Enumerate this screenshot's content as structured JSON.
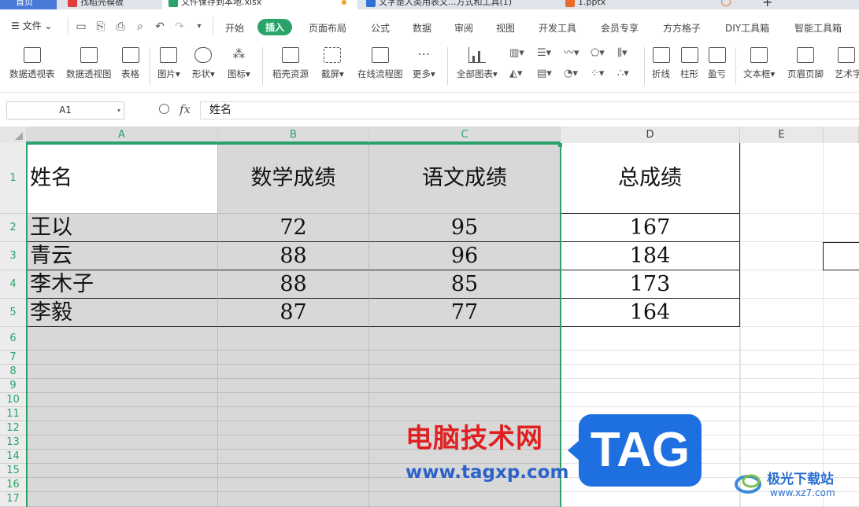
{
  "tabs": [
    {
      "id": "home",
      "label": "首页"
    },
    {
      "id": "templates",
      "label": "找稻壳模板"
    },
    {
      "id": "xlsx",
      "label": "文件保存到本地.xlsx"
    },
    {
      "id": "doc",
      "label": "文字是人类用表文...方式和工具(1)"
    },
    {
      "id": "pptx",
      "label": "1.pptx"
    }
  ],
  "menu": {
    "file_label": "文件",
    "tabs": [
      "开始",
      "插入",
      "页面布局",
      "公式",
      "数据",
      "审阅",
      "视图",
      "开发工具",
      "会员专享",
      "方方格子",
      "DIY工具箱",
      "智能工具箱"
    ],
    "active_tab": "插入"
  },
  "ribbon": {
    "buttons": [
      {
        "label": "数据透视表",
        "icon": "pivot-table-icon"
      },
      {
        "label": "数据透视图",
        "icon": "pivot-chart-icon"
      },
      {
        "label": "表格",
        "icon": "table-icon"
      },
      {
        "label": "图片",
        "icon": "picture-icon"
      },
      {
        "label": "形状",
        "icon": "shape-icon"
      },
      {
        "label": "图标",
        "icon": "icons-icon"
      },
      {
        "label": "稻壳资源",
        "icon": "resource-icon"
      },
      {
        "label": "截屏",
        "icon": "screenshot-icon"
      },
      {
        "label": "在线流程图",
        "icon": "flowchart-icon"
      },
      {
        "label": "更多",
        "icon": "more-icon"
      },
      {
        "label": "全部图表",
        "icon": "all-charts-icon"
      },
      {
        "label": "折线",
        "icon": "line-sparkline-icon"
      },
      {
        "label": "柱形",
        "icon": "column-sparkline-icon"
      },
      {
        "label": "盈亏",
        "icon": "winloss-sparkline-icon"
      },
      {
        "label": "文本框",
        "icon": "textbox-icon"
      },
      {
        "label": "页眉页脚",
        "icon": "header-footer-icon"
      },
      {
        "label": "艺术字",
        "icon": "wordart-icon"
      }
    ]
  },
  "formula_bar": {
    "cell_ref": "A1",
    "fx": "fx",
    "content": "姓名"
  },
  "sheet": {
    "columns": [
      "A",
      "B",
      "C",
      "D",
      "E"
    ],
    "rows": [
      "1",
      "2",
      "3",
      "4",
      "5",
      "6",
      "7",
      "8",
      "9",
      "10",
      "11",
      "12",
      "13",
      "14",
      "15",
      "16",
      "17"
    ],
    "header": [
      "姓名",
      "数学成绩",
      "语文成绩",
      "总成绩"
    ],
    "data": [
      [
        "王以",
        "72",
        "95",
        "167"
      ],
      [
        "青云",
        "88",
        "96",
        "184"
      ],
      [
        "李木子",
        "88",
        "85",
        "173"
      ],
      [
        "李毅",
        "87",
        "77",
        "164"
      ]
    ],
    "selection": "A1:C17",
    "selection_color": "#2aa36a"
  },
  "watermark": {
    "cn": "电脑技术网",
    "url": "www.tagxp.com",
    "tag": "TAG",
    "site": "极光下载站",
    "site_url": "www.xz7.com"
  },
  "colors": {
    "accent": "#2aa36a",
    "tab_blue": "#4a7ad8"
  }
}
